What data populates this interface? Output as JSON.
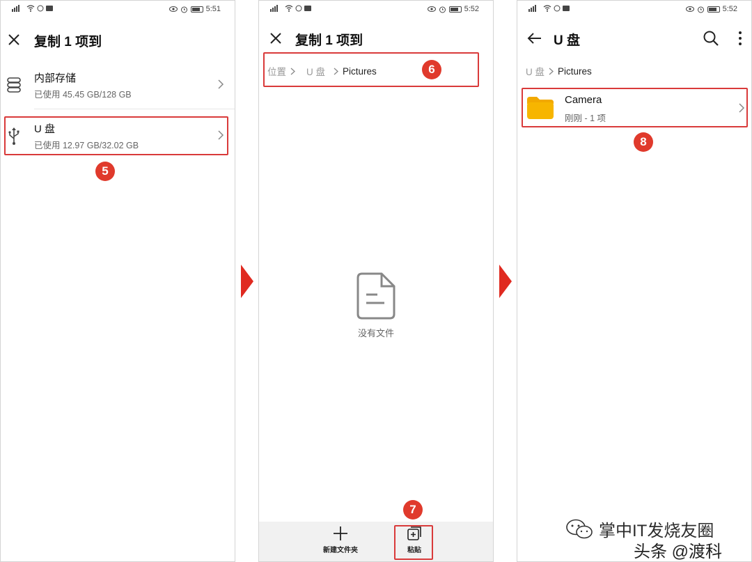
{
  "panels": [
    {
      "status": {
        "time": "5:51"
      },
      "title": "复制 1 项到",
      "storage": [
        {
          "name": "内部存储",
          "usage": "已使用 45.45 GB/128 GB"
        },
        {
          "name": "U 盘",
          "usage": "已使用 12.97 GB/32.02 GB"
        }
      ],
      "step_badge": "5"
    },
    {
      "status": {
        "time": "5:52"
      },
      "title": "复制 1 项到",
      "breadcrumb": [
        "位置",
        "U 盘",
        "Pictures"
      ],
      "step_badge": "6",
      "empty_label": "没有文件",
      "bottom": {
        "new_folder": "新建文件夹",
        "paste": "粘贴"
      },
      "step_badge_2": "7"
    },
    {
      "status": {
        "time": "5:52"
      },
      "title": "U 盘",
      "breadcrumb": [
        "U 盘",
        "Pictures"
      ],
      "folder": {
        "name": "Camera",
        "meta": "刚刚 - 1 项"
      },
      "step_badge": "8"
    }
  ],
  "watermark": {
    "line1": "掌中IT发烧友圈",
    "line2": "头条 @渡科"
  },
  "colors": {
    "highlight": "#d93a3a",
    "badge": "#e03a2c",
    "folder": "#f7b500",
    "arrow": "#e02a20"
  },
  "icons": [
    "storage-icon",
    "usb-icon",
    "close-icon",
    "back-arrow-icon",
    "search-icon",
    "more-icon",
    "chevron-right-icon",
    "file-icon",
    "plus-icon",
    "paste-icon",
    "folder-icon",
    "wechat-icon"
  ]
}
